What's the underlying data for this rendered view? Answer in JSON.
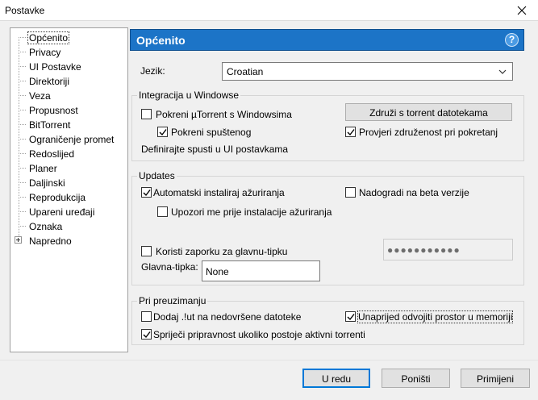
{
  "window": {
    "title": "Postavke"
  },
  "sidebar": {
    "items": [
      {
        "label": "Općenito",
        "selected": true
      },
      {
        "label": "Privacy"
      },
      {
        "label": "UI Postavke"
      },
      {
        "label": "Direktoriji"
      },
      {
        "label": "Veza"
      },
      {
        "label": "Propusnost"
      },
      {
        "label": "BitTorrent"
      },
      {
        "label": "Ograničenje promet"
      },
      {
        "label": "Redoslijed"
      },
      {
        "label": "Planer"
      },
      {
        "label": "Daljinski"
      },
      {
        "label": "Reprodukcija"
      },
      {
        "label": "Upareni uređaji"
      },
      {
        "label": "Oznaka"
      },
      {
        "label": "Napredno",
        "expandable": true
      }
    ]
  },
  "header": {
    "title": "Općenito",
    "help": "?"
  },
  "language": {
    "label": "Jezik:",
    "value": "Croatian"
  },
  "integration": {
    "legend": "Integracija u Windowse",
    "start_with_windows": {
      "label": "Pokreni µTorrent s Windowsima",
      "checked": false
    },
    "start_minimized": {
      "label": "Pokreni spuštenog",
      "checked": true
    },
    "associate_button": "Združi s torrent datotekama",
    "check_association": {
      "label": "Provjeri združenost pri pokretanj",
      "checked": true
    },
    "ui_note": "Definirajte spusti u UI postavkama"
  },
  "updates": {
    "legend": "Updates",
    "auto_install": {
      "label": "Automatski instaliraj ažuriranja",
      "checked": true
    },
    "beta": {
      "label": "Nadogradi na beta verzije",
      "checked": false
    },
    "notify": {
      "label": "Upozori me prije instalacije ažuriranja",
      "checked": false
    },
    "boss_key_password": {
      "label": "Koristi zaporku za glavnu-tipku",
      "checked": false
    },
    "password_value": "●●●●●●●●●●●",
    "boss_key_label": "Glavna-tipka:",
    "boss_key_value": "None"
  },
  "downloading": {
    "legend": "Pri preuzimanju",
    "append_ut": {
      "label": "Dodaj .!ut na nedovršene datoteke",
      "checked": false
    },
    "preallocate": {
      "label": "Unaprijed odvojiti prostor u memoriji",
      "checked": true
    },
    "prevent_standby": {
      "label": "Spriječi pripravnost ukoliko postoje aktivni torrenti",
      "checked": true
    }
  },
  "footer": {
    "ok": "U redu",
    "cancel": "Poništi",
    "apply": "Primijeni"
  }
}
